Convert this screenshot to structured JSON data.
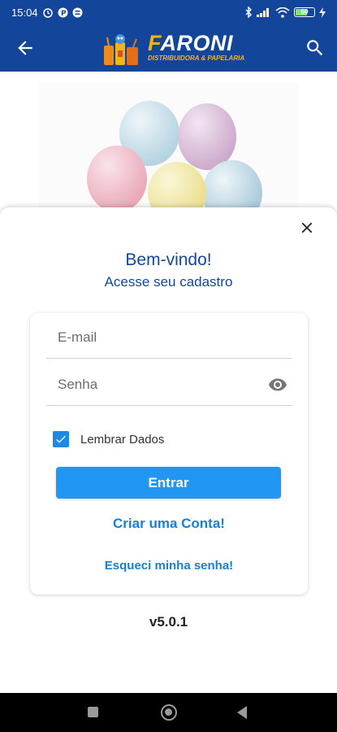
{
  "status_bar": {
    "time": "15:04",
    "icons_left": [
      "alarm-icon",
      "p-icon",
      "sync-icon"
    ],
    "icons_right": [
      "bluetooth-icon",
      "signal-icon",
      "wifi-icon",
      "battery-icon",
      "charging-icon"
    ],
    "battery_level": "60"
  },
  "app_bar": {
    "brand_name": "ARONI",
    "brand_initial": "F",
    "brand_subtitle": "DISTRIBUIDORA & PAPELARIA",
    "back_icon": "arrow-back-icon",
    "search_icon": "search-icon"
  },
  "login": {
    "welcome": "Bem-vindo!",
    "subtitle": "Acesse seu cadastro",
    "email_placeholder": "E-mail",
    "password_placeholder": "Senha",
    "remember_label": "Lembrar Dados",
    "remember_checked": true,
    "submit_label": "Entrar",
    "create_account_label": "Criar uma Conta!",
    "forgot_password_label": "Esqueci minha senha!"
  },
  "version": "v5.0.1",
  "colors": {
    "primary": "#13469a",
    "accent": "#2196f3",
    "link": "#1b7fd0"
  }
}
